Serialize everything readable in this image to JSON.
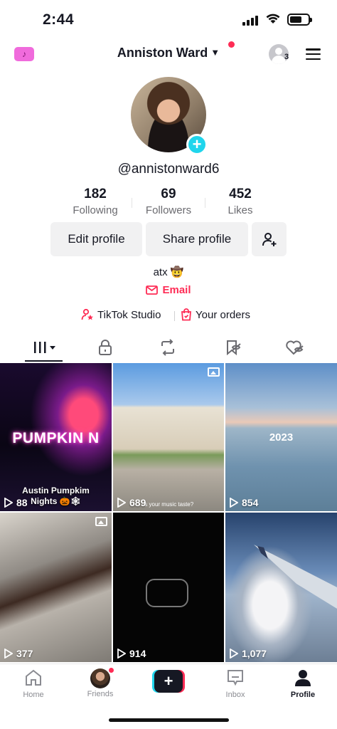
{
  "status_bar": {
    "time": "2:44"
  },
  "header": {
    "username": "Anniston Ward",
    "viewers_count": "3"
  },
  "profile": {
    "handle": "@annistonward6",
    "stats": [
      {
        "value": "182",
        "label": "Following"
      },
      {
        "value": "69",
        "label": "Followers"
      },
      {
        "value": "452",
        "label": "Likes"
      }
    ],
    "edit_label": "Edit profile",
    "share_label": "Share profile",
    "bio": "atx 🤠",
    "email_label": "Email",
    "studio_label": "TikTok Studio",
    "orders_label": "Your orders"
  },
  "tabs": [
    "videos",
    "private",
    "reposts",
    "favorites",
    "liked"
  ],
  "videos": [
    {
      "views": "88",
      "caption": "Austin Pumpkim Nights 🎃🕸",
      "sign": "PUMPKIN N"
    },
    {
      "views": "689",
      "caption": "'s your music taste?"
    },
    {
      "views": "854",
      "caption": "2023"
    },
    {
      "views": "377"
    },
    {
      "views": "914"
    },
    {
      "views": "1,077"
    }
  ],
  "nav": {
    "home": "Home",
    "friends": "Friends",
    "inbox": "Inbox",
    "profile": "Profile"
  },
  "colors": {
    "accent": "#fe2c55",
    "cyan": "#20d5ec"
  }
}
